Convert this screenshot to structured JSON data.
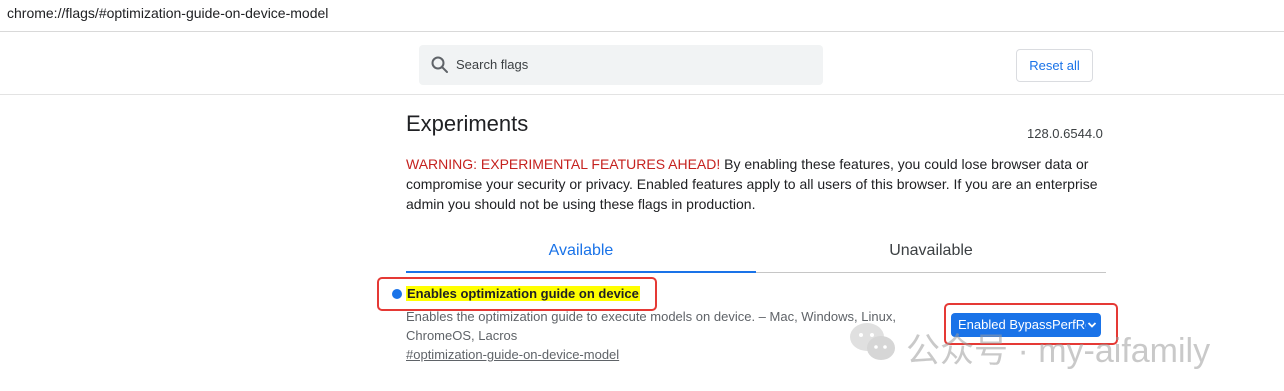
{
  "address_bar": {
    "url": "chrome://flags/#optimization-guide-on-device-model"
  },
  "header": {
    "search_placeholder": "Search flags",
    "search_icon": "search-icon",
    "reset_label": "Reset all"
  },
  "main": {
    "title": "Experiments",
    "version": "128.0.6544.0",
    "warning_prefix": "WARNING: EXPERIMENTAL FEATURES AHEAD!",
    "warning_text": " By enabling these features, you could lose browser data or compromise your security or privacy. Enabled features apply to all users of this browser. If you are an enterprise admin you should not be using these flags in production.",
    "tabs": [
      {
        "label": "Available",
        "active": true
      },
      {
        "label": "Unavailable",
        "active": false
      }
    ]
  },
  "flag": {
    "title": "Enables optimization guide on device",
    "description": "Enables the optimization guide to execute models on device. – Mac, Windows, Linux, ChromeOS, Lacros",
    "link": "#optimization-guide-on-device-model",
    "select_value": "Enabled BypassPerfRequirement"
  },
  "watermark": {
    "text": "公众号 · my-aifamily"
  },
  "colors": {
    "accent": "#1a73e8",
    "warning": "#c5221f",
    "highlight": "#ffff00",
    "annotation": "#e53935"
  }
}
